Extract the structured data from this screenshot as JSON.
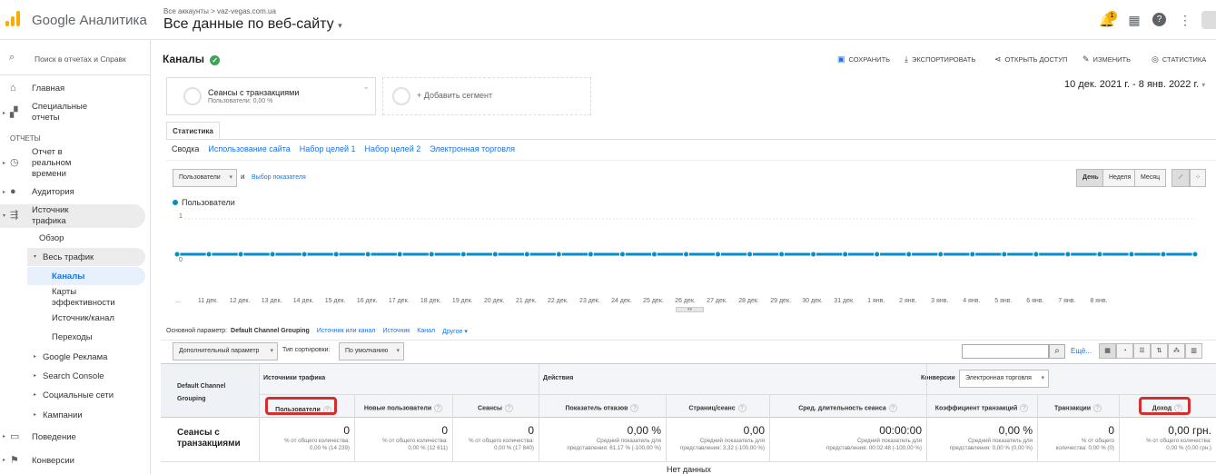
{
  "header": {
    "app_name": "Google Аналитика",
    "breadcrumb_all_accounts": "Все аккаунты",
    "breadcrumb_separator": ">",
    "breadcrumb_site": "vaz-vegas.com.ua",
    "view_name": "Все данные по веб-сайту",
    "notifications_count": "1"
  },
  "sidebar": {
    "search_placeholder": "Поиск в отчетах и Справк",
    "home": "Главная",
    "custom_reports": "Специальные отчеты",
    "section_reports": "ОТЧЕТЫ",
    "realtime": "Отчет в реальном времени",
    "audience": "Аудитория",
    "acquisition": "Источник трафика",
    "overview": "Обзор",
    "all_traffic": "Весь трафик",
    "channels": "Каналы",
    "treemaps": "Карты эффективности",
    "source_medium": "Источник/канал",
    "referrals": "Переходы",
    "google_ads": "Google Реклама",
    "search_console": "Search Console",
    "social": "Социальные сети",
    "campaigns": "Кампании",
    "behavior": "Поведение",
    "conversions": "Конверсии"
  },
  "report": {
    "title": "Каналы",
    "save": "СОХРАНИТЬ",
    "export": "ЭКСПОРТИРОВАТЬ",
    "share": "ОТКРЫТЬ ДОСТУП",
    "edit": "ИЗМЕНИТЬ",
    "insights": "СТАТИСТИКА",
    "date_range": "10 дек. 2021 г. - 8 янв. 2022 г.",
    "segment_name": "Сеансы с транзакциями",
    "segment_sub": "Пользователи: 0,00 %",
    "add_segment": "+ Добавить сегмент",
    "explorer_tab": "Статистика",
    "subtabs": [
      "Сводка",
      "Использование сайта",
      "Набор целей 1",
      "Набор целей 2",
      "Электронная торговля"
    ],
    "metric_select": "Пользователи",
    "metric_and": "и",
    "select_metric": "Выбор показателя",
    "granularity": [
      "День",
      "Неделя",
      "Месяц"
    ],
    "legend_series": "Пользователи",
    "primary_dim_label": "Основной параметр:",
    "primary_dim": "Default Channel Grouping",
    "dim_options": [
      "Источник или канал",
      "Источник",
      "Канал",
      "Другое"
    ],
    "secondary_dim": "Дополнительный параметр",
    "sort_type_label": "Тип сортировки:",
    "sort_type": "По умолчанию",
    "advanced": "Ещё...",
    "no_data": "Нет данных"
  },
  "chart_data": {
    "type": "line",
    "series": [
      {
        "name": "Пользователи",
        "values": [
          0,
          0,
          0,
          0,
          0,
          0,
          0,
          0,
          0,
          0,
          0,
          0,
          0,
          0,
          0,
          0,
          0,
          0,
          0,
          0,
          0,
          0,
          0,
          0,
          0,
          0,
          0,
          0,
          0,
          0,
          0,
          0,
          0
        ]
      }
    ],
    "x": [
      "...",
      "",
      "11 дек.",
      "12 дек.",
      "13 дек.",
      "14 дек.",
      "15 дек.",
      "16 дек.",
      "17 дек.",
      "18 дек.",
      "19 дек.",
      "20 дек.",
      "21 дек.",
      "22 дек.",
      "23 дек.",
      "24 дек.",
      "25 дек.",
      "26 дек.",
      "27 дек.",
      "28 дек.",
      "29 дек.",
      "30 дек.",
      "31 дек.",
      "1 янв.",
      "2 янв.",
      "3 янв.",
      "4 янв.",
      "5 янв.",
      "6 янв.",
      "7 янв.",
      "8 янв."
    ],
    "yticks": [
      "1",
      "0"
    ],
    "ylim": [
      0,
      1
    ],
    "color": "#058dc7"
  },
  "table": {
    "dim_header": "Default Channel Grouping",
    "group_acq": "Источники трафика",
    "group_beh": "Действия",
    "group_conv": "Конверсии",
    "conv_select": "Электронная торговля",
    "columns": [
      "Пользователи",
      "Новые пользователи",
      "Сеансы",
      "Показатель отказов",
      "Страниц/сеанс",
      "Сред. длительность сеанса",
      "Коэффициент транзакций",
      "Транзакции",
      "Доход"
    ],
    "row_label": "Сеансы с транзакциями",
    "values": [
      "0",
      "0",
      "0",
      "0,00 %",
      "0,00",
      "00:00:00",
      "0,00 %",
      "0",
      "0,00 грн."
    ],
    "sub_a": [
      "% от общего количества:",
      "% от общего количества:",
      "% от общего количества:",
      "Средний показатель для",
      "Средний показатель для",
      "Средний показатель для",
      "Средний показатель для",
      "% от общего",
      "% от общего количества:"
    ],
    "sub_b": [
      "0,00 % (14 239)",
      "0,00 % (12 611)",
      "0,00 % (17 840)",
      "представления: 61,17 % (-100,00 %)",
      "представления: 3,32 (-100,00 %)",
      "представления: 00:02:48 (-100,00 %)",
      "представления: 0,00 % (0,00 %)",
      "количества: 0,00 % (0)",
      "0,00 % (0,00 грн.)"
    ]
  },
  "accent": "#1a73e8",
  "highlight": "#d32f2f"
}
